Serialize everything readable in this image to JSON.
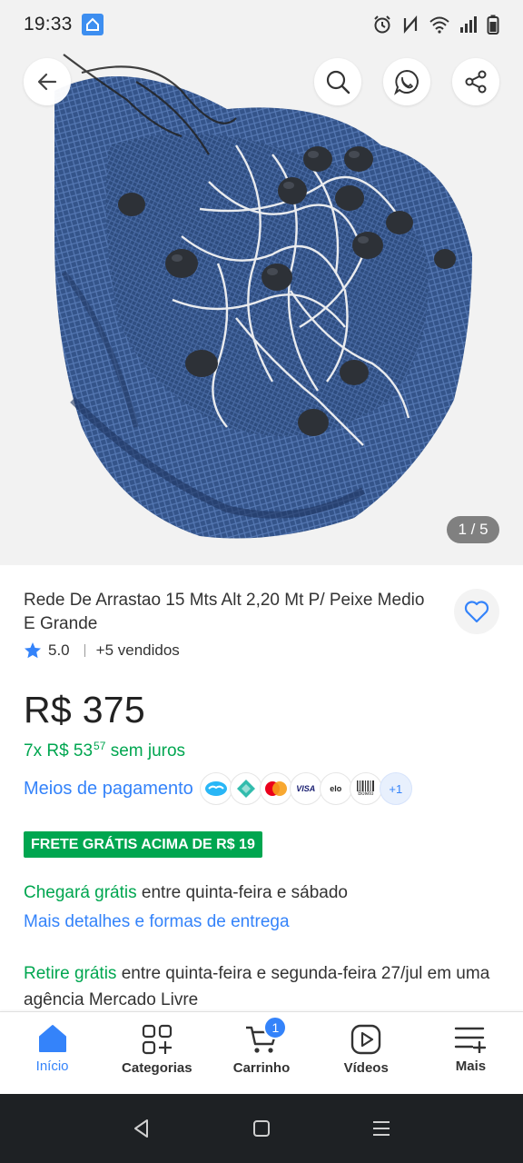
{
  "status_bar": {
    "time": "19:33",
    "icons": [
      "home-app-icon",
      "alarm-icon",
      "nfc-icon",
      "wifi-icon",
      "signal-icon",
      "battery-icon"
    ]
  },
  "hero": {
    "image_counter": "1 / 5",
    "buttons": [
      "back-arrow-icon",
      "search-icon",
      "whatsapp-icon",
      "share-icon"
    ],
    "photo_subject": "blue fishing net with black floats"
  },
  "product": {
    "title": "Rede De Arrastao 15 Mts Alt 2,20 Mt P/ Peixe Medio E Grande",
    "rating": "5.0",
    "sold": "+5 vendidos",
    "price": "R$ 375",
    "installments_prefix": "7x R$ 53",
    "installments_cents": "57",
    "installments_suffix": "sem juros",
    "payment_link": "Meios de pagamento",
    "payment_methods": [
      "mercado-pago",
      "pix",
      "mastercard",
      "VISA",
      "elo",
      "Boleto"
    ],
    "payment_more": "+1",
    "free_shipping_badge": "FRETE GRÁTIS ACIMA DE R$ 19",
    "delivery_highlight": "Chegará grátis",
    "delivery_text": " entre quinta-feira e sábado",
    "delivery_more": "Mais detalhes e formas de entrega",
    "pickup_highlight": "Retire grátis",
    "pickup_text": " entre quinta-feira e segunda-feira 27/jul em uma agência Mercado Livre"
  },
  "bottom_nav": {
    "items": [
      {
        "label": "Início",
        "icon": "home-icon"
      },
      {
        "label": "Categorias",
        "icon": "categories-icon"
      },
      {
        "label": "Carrinho",
        "icon": "cart-icon"
      },
      {
        "label": "Vídeos",
        "icon": "video-icon"
      },
      {
        "label": "Mais",
        "icon": "menu-more-icon"
      }
    ],
    "cart_count": "1"
  },
  "colors": {
    "accent_blue": "#3483fa",
    "green": "#00a650",
    "net_blue": "#3b5a8f",
    "android_nav": "#1e2124"
  }
}
